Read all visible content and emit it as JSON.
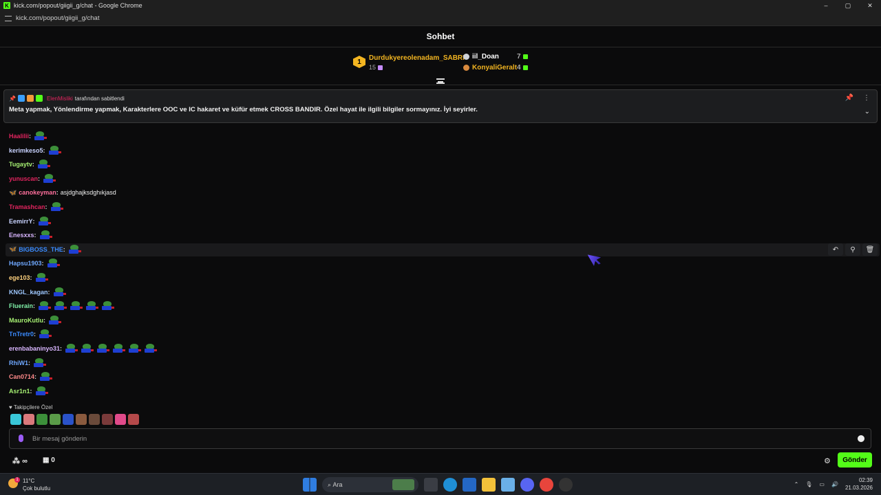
{
  "browser": {
    "window_title": "kick.com/popout/giigii_g/chat - Google Chrome",
    "url": "kick.com/popout/giigii_g/chat",
    "controls": {
      "minimize": "–",
      "maximize": "▢",
      "close": "✕"
    }
  },
  "chat_header": {
    "title": "Sohbet"
  },
  "leaderboard": {
    "first": {
      "rank": "1",
      "name": "Durdukyereolenadam_SABRI",
      "count": "15"
    },
    "second": {
      "name": "iil_Doan",
      "count": "7"
    },
    "third": {
      "name": "KonyaliGeralt",
      "count": "4"
    }
  },
  "pinned": {
    "pinner": "ElenMisliki",
    "pinned_by_suffix": "tarafından sabitlendi",
    "message": "Meta yapmak, Yönlendirme yapmak, Karakterlere OOC ve IC hakaret ve küfür etmek CROSS BANDIR. Özel hayat ile ilgili bilgiler sormayınız. İyi seyirler."
  },
  "messages": [
    {
      "user": "Haalilii",
      "color": "#e0245e",
      "emotes": 1,
      "text": ""
    },
    {
      "user": "kerimkeso5",
      "color": "#c9d3ff",
      "emotes": 1,
      "text": ""
    },
    {
      "user": "Tugaytv",
      "color": "#a6f072",
      "emotes": 1,
      "text": ""
    },
    {
      "user": "yunuscan",
      "color": "#e0245e",
      "emotes": 1,
      "text": ""
    },
    {
      "user": "canokeyman",
      "color": "#ff6f9c",
      "emotes": 0,
      "text": "asjdghajksdghıkjasd"
    },
    {
      "user": "Tramashcan",
      "color": "#e0245e",
      "emotes": 1,
      "text": ""
    },
    {
      "user": "EemirrY",
      "color": "#c9d3ff",
      "emotes": 1,
      "text": ""
    },
    {
      "user": "Enesxxs",
      "color": "#d9b6ff",
      "emotes": 1,
      "text": ""
    },
    {
      "user": "BIGBOSS_THE",
      "color": "#3a8bff",
      "emotes": 1,
      "text": ""
    },
    {
      "user": "Hapsu1903",
      "color": "#6fa8ff",
      "emotes": 1,
      "text": ""
    },
    {
      "user": "ege103",
      "color": "#ffd27f",
      "emotes": 1,
      "text": ""
    },
    {
      "user": "KNGL_kagan",
      "color": "#9ec8ff",
      "emotes": 1,
      "text": ""
    },
    {
      "user": "Fluerain",
      "color": "#7ff0a8",
      "emotes": 5,
      "text": ""
    },
    {
      "user": "MauroKutlu",
      "color": "#a6f072",
      "emotes": 1,
      "text": ""
    },
    {
      "user": "TnTretr0",
      "color": "#3a8bff",
      "emotes": 1,
      "text": ""
    },
    {
      "user": "erenbabaninyo31",
      "color": "#d9b6ff",
      "emotes": 6,
      "text": ""
    },
    {
      "user": "RhiW1",
      "color": "#6fa8ff",
      "emotes": 1,
      "text": ""
    },
    {
      "user": "Can0714",
      "color": "#ff8a8a",
      "emotes": 1,
      "text": ""
    },
    {
      "user": "Asr1n1",
      "color": "#a6f072",
      "emotes": 1,
      "text": ""
    }
  ],
  "highlight_actions": {
    "reply": "↶",
    "pin": "⚲",
    "delete": "🗑"
  },
  "followers_only": {
    "label": "Takipçilere Özel"
  },
  "input": {
    "placeholder": "Bir mesaj gönderin"
  },
  "footer": {
    "points": "∞",
    "store_count": "0",
    "send_label": "Gönder"
  },
  "taskbar": {
    "temperature": "11°C",
    "weather": "Çok bulutlu",
    "search_label": "Ara",
    "time": "02:39",
    "date": "21.03.2026",
    "notification_count": "1"
  },
  "colors": {
    "accent": "#53fc18",
    "gold": "#f3b521",
    "pinner": "#e0245e"
  }
}
